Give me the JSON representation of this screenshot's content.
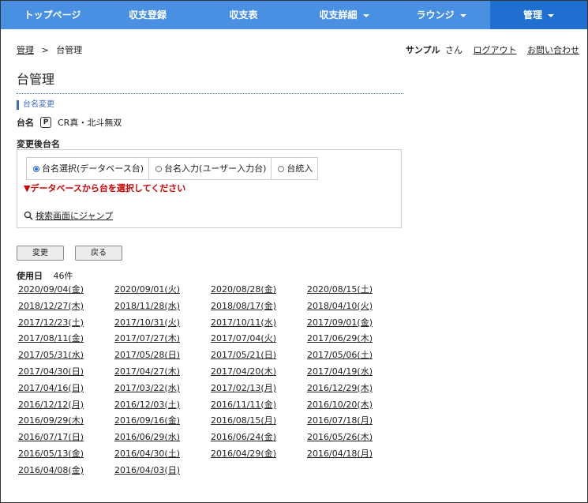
{
  "nav": {
    "items": [
      {
        "label": "トップページ",
        "dropdown": false,
        "active": false
      },
      {
        "label": "収支登録",
        "dropdown": false,
        "active": false
      },
      {
        "label": "収支表",
        "dropdown": false,
        "active": false
      },
      {
        "label": "収支詳細",
        "dropdown": true,
        "active": false
      },
      {
        "label": "ラウンジ",
        "dropdown": true,
        "active": false
      },
      {
        "label": "管理",
        "dropdown": true,
        "active": true
      }
    ]
  },
  "breadcrumb": {
    "parent": "管理",
    "separator": ">",
    "current": "台管理"
  },
  "user": {
    "name": "サンプル",
    "suffix": "さん",
    "logout": "ログアウト",
    "contact": "お問い合わせ"
  },
  "page": {
    "title": "台管理"
  },
  "section": {
    "heading": "台名変更"
  },
  "current_machine": {
    "label": "台名",
    "badge": "P",
    "name": "CR真・北斗無双"
  },
  "new_name": {
    "label": "変更後台名",
    "tabs": [
      {
        "label": "台名選択(データベース台)",
        "selected": true
      },
      {
        "label": "台名入力(ユーザー入力台)",
        "selected": false
      },
      {
        "label": "台統入",
        "selected": false
      }
    ],
    "warning": "▼データベースから台を選択してください",
    "jump_link": "検索画面にジャンプ"
  },
  "buttons": {
    "change": "変更",
    "back": "戻る"
  },
  "usage": {
    "label": "使用日",
    "count": "46件",
    "dates": [
      "2020/09/04(金)",
      "2020/09/01(火)",
      "2020/08/28(金)",
      "2020/08/15(土)",
      "2018/12/27(木)",
      "2018/11/28(水)",
      "2018/08/17(金)",
      "2018/04/10(火)",
      "2017/12/23(土)",
      "2017/10/31(火)",
      "2017/10/11(水)",
      "2017/09/01(金)",
      "2017/08/11(金)",
      "2017/07/27(木)",
      "2017/07/04(火)",
      "2017/06/29(木)",
      "2017/05/31(水)",
      "2017/05/28(日)",
      "2017/05/21(日)",
      "2017/05/06(土)",
      "2017/04/30(日)",
      "2017/04/27(木)",
      "2017/04/20(木)",
      "2017/04/19(水)",
      "2017/04/16(日)",
      "2017/03/22(水)",
      "2017/02/13(月)",
      "2016/12/29(木)",
      "2016/12/12(月)",
      "2016/12/03(土)",
      "2016/11/11(金)",
      "2016/10/20(木)",
      "2016/09/29(木)",
      "2016/09/16(金)",
      "2016/08/15(月)",
      "2016/07/18(月)",
      "2016/07/17(日)",
      "2016/06/29(水)",
      "2016/06/24(金)",
      "2016/05/26(木)",
      "2016/05/13(金)",
      "2016/04/30(土)",
      "2016/04/29(金)",
      "2016/04/18(月)",
      "2016/04/08(金)",
      "2016/04/03(日)"
    ]
  }
}
